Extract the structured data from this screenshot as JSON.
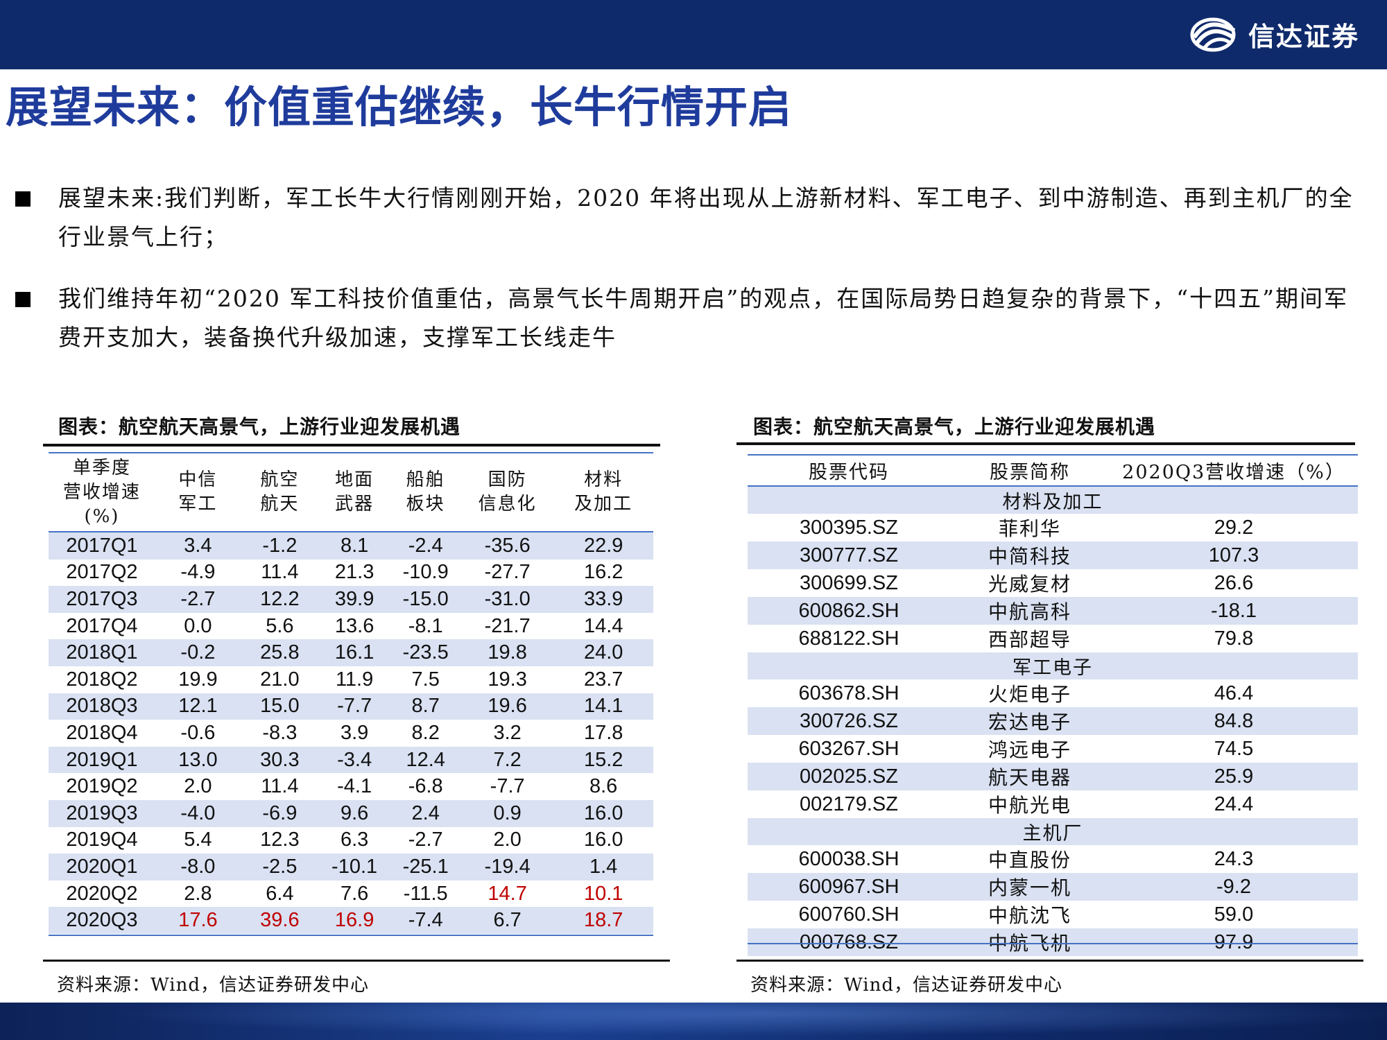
{
  "brand": {
    "name": "信达证券",
    "logo_icon": "wave-logo-icon",
    "color": "#0f2a6b"
  },
  "title": "展望未来：价值重估继续，长牛行情开启",
  "bullets": [
    "展望未来:我们判断，军工长牛大行情刚刚开始，2020 年将出现从上游新材料、军工电子、到中游制造、再到主机厂的全行业景气上行；",
    "我们维持年初“2020 军工科技价值重估，高景气长牛周期开启”的观点，在国际局势日趋复杂的背景下，“十四五”期间军费开支加大，装备换代升级加速，支撑军工长线走牛"
  ],
  "left_table": {
    "caption": "图表：航空航天高景气，上游行业迎发展机遇",
    "headers": [
      [
        "单季度",
        "营收增速",
        "(%)"
      ],
      [
        "中信",
        "军工"
      ],
      [
        "航空",
        "航天"
      ],
      [
        "地面",
        "武器"
      ],
      [
        "船舶",
        "板块"
      ],
      [
        "国防",
        "信息化"
      ],
      [
        "材料",
        "及加工"
      ]
    ],
    "rows": [
      [
        "2017Q1",
        "3.4",
        "-1.2",
        "8.1",
        "-2.4",
        "-35.6",
        "22.9"
      ],
      [
        "2017Q2",
        "-4.9",
        "11.4",
        "21.3",
        "-10.9",
        "-27.7",
        "16.2"
      ],
      [
        "2017Q3",
        "-2.7",
        "12.2",
        "39.9",
        "-15.0",
        "-31.0",
        "33.9"
      ],
      [
        "2017Q4",
        "0.0",
        "5.6",
        "13.6",
        "-8.1",
        "-21.7",
        "14.4"
      ],
      [
        "2018Q1",
        "-0.2",
        "25.8",
        "16.1",
        "-23.5",
        "19.8",
        "24.0"
      ],
      [
        "2018Q2",
        "19.9",
        "21.0",
        "11.9",
        "7.5",
        "19.3",
        "23.7"
      ],
      [
        "2018Q3",
        "12.1",
        "15.0",
        "-7.7",
        "8.7",
        "19.6",
        "14.1"
      ],
      [
        "2018Q4",
        "-0.6",
        "-8.3",
        "3.9",
        "8.2",
        "3.2",
        "17.8"
      ],
      [
        "2019Q1",
        "13.0",
        "30.3",
        "-3.4",
        "12.4",
        "7.2",
        "15.2"
      ],
      [
        "2019Q2",
        "2.0",
        "11.4",
        "-4.1",
        "-6.8",
        "-7.7",
        "8.6"
      ],
      [
        "2019Q3",
        "-4.0",
        "-6.9",
        "9.6",
        "2.4",
        "0.9",
        "16.0"
      ],
      [
        "2019Q4",
        "5.4",
        "12.3",
        "6.3",
        "-2.7",
        "2.0",
        "16.0"
      ],
      [
        "2020Q1",
        "-8.0",
        "-2.5",
        "-10.1",
        "-25.1",
        "-19.4",
        "1.4"
      ],
      [
        "2020Q2",
        "2.8",
        "6.4",
        "7.6",
        "-11.5",
        "14.7",
        "10.1"
      ],
      [
        "2020Q3",
        "17.6",
        "39.6",
        "16.9",
        "-7.4",
        "6.7",
        "18.7"
      ]
    ],
    "highlight_color": "#c00000",
    "source": "资料来源：Wind，信达证券研发中心"
  },
  "right_table": {
    "caption": "图表：航空航天高景气，上游行业迎发展机遇",
    "headers": [
      "股票代码",
      "股票简称",
      "2020Q3营收增速（%）"
    ],
    "groups": [
      {
        "name": "材料及加工",
        "rows": [
          [
            "300395.SZ",
            "菲利华",
            "29.2"
          ],
          [
            "300777.SZ",
            "中简科技",
            "107.3"
          ],
          [
            "300699.SZ",
            "光威复材",
            "26.6"
          ],
          [
            "600862.SH",
            "中航高科",
            "-18.1"
          ],
          [
            "688122.SH",
            "西部超导",
            "79.8"
          ]
        ]
      },
      {
        "name": "军工电子",
        "rows": [
          [
            "603678.SH",
            "火炬电子",
            "46.4"
          ],
          [
            "300726.SZ",
            "宏达电子",
            "84.8"
          ],
          [
            "603267.SH",
            "鸿远电子",
            "74.5"
          ],
          [
            "002025.SZ",
            "航天电器",
            "25.9"
          ],
          [
            "002179.SZ",
            "中航光电",
            "24.4"
          ]
        ]
      },
      {
        "name": "主机厂",
        "rows": [
          [
            "600038.SH",
            "中直股份",
            "24.3"
          ],
          [
            "600967.SH",
            "内蒙一机",
            "-9.2"
          ],
          [
            "600760.SH",
            "中航沈飞",
            "59.0"
          ],
          [
            "000768.SZ",
            "中航飞机",
            "97.9"
          ]
        ]
      }
    ],
    "source": "资料来源：Wind，信达证券研发中心"
  }
}
